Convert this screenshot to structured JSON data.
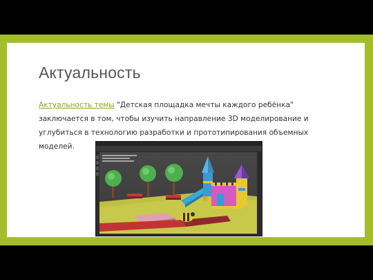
{
  "slide": {
    "title": "Актуальность",
    "link_text": "Актуальность темы",
    "body_text": " \"Детская площадка мечты каждого ребёнка\" заключается в том,  чтобы изучить направление 3D моделирование и углубиться в технологию разработки и прототипирования объемных моделей."
  },
  "colors": {
    "frame": "#a4bd2a",
    "link": "#8aa326",
    "title": "#555555"
  },
  "screenshot": {
    "app": "Blender 3D viewport",
    "icons": [
      "tree-icon",
      "tower-icon",
      "slide-icon",
      "bench-icon",
      "bee-icon"
    ]
  }
}
